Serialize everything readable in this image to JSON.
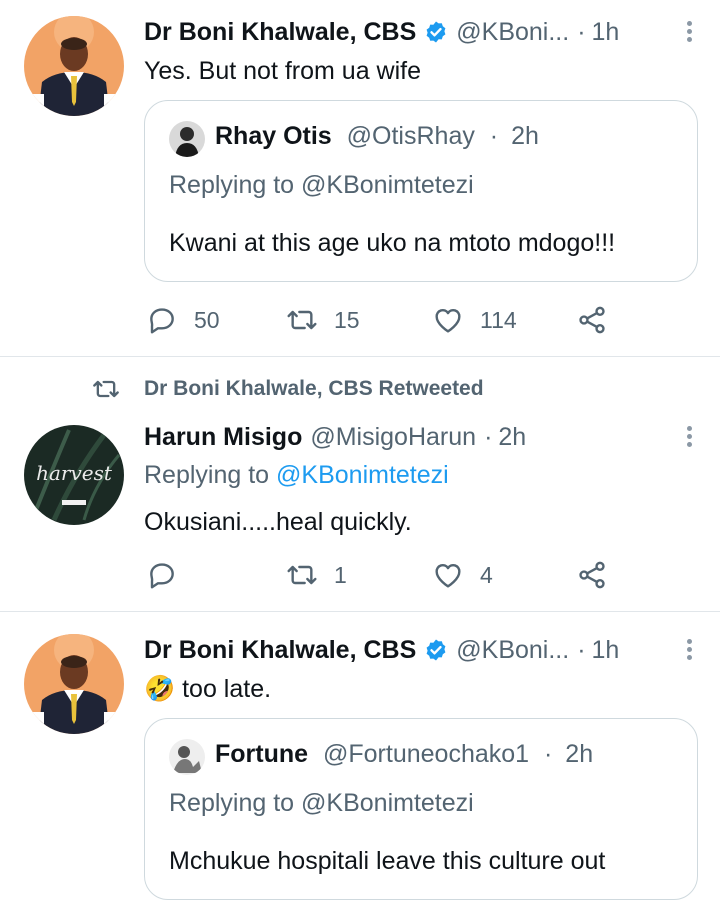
{
  "tweets": [
    {
      "author_name": "Dr Boni Khalwale, CBS",
      "author_handle": "@KBoni...",
      "time": "1h",
      "text": "Yes. But not from ua wife",
      "quote": {
        "author_name": "Rhay Otis",
        "author_handle": "@OtisRhay",
        "time": "2h",
        "replying_label": "Replying to",
        "replying_to": "@KBonimtetezi",
        "text": "Kwani at this age uko na mtoto mdogo!!!"
      },
      "actions": {
        "replies": "50",
        "retweets": "15",
        "likes": "114"
      }
    },
    {
      "retweet_context": "Dr Boni Khalwale, CBS Retweeted",
      "author_name": "Harun Misigo",
      "author_handle": "@MisigoHarun",
      "time": "2h",
      "replying_label": "Replying to",
      "replying_to": "@KBonimtetezi",
      "text": "Okusiani.....heal quickly.",
      "avatar_text": "harvest",
      "actions": {
        "replies": "",
        "retweets": "1",
        "likes": "4"
      }
    },
    {
      "author_name": "Dr Boni Khalwale, CBS",
      "author_handle": "@KBoni...",
      "time": "1h",
      "emoji": "🤣",
      "text": "too late.",
      "quote": {
        "author_name": "Fortune",
        "author_handle": "@Fortuneochako1",
        "time": "2h",
        "replying_label": "Replying to",
        "replying_to": "@KBonimtetezi",
        "text": "Mchukue hospitali leave this culture out"
      }
    }
  ],
  "separator": "·",
  "colors": {
    "accent": "#1d9bf0",
    "secondary_text": "#536471",
    "border": "#cfd9de"
  },
  "icons": [
    "verified-badge-icon",
    "reply-icon",
    "retweet-icon",
    "like-icon",
    "share-icon",
    "more-icon"
  ]
}
